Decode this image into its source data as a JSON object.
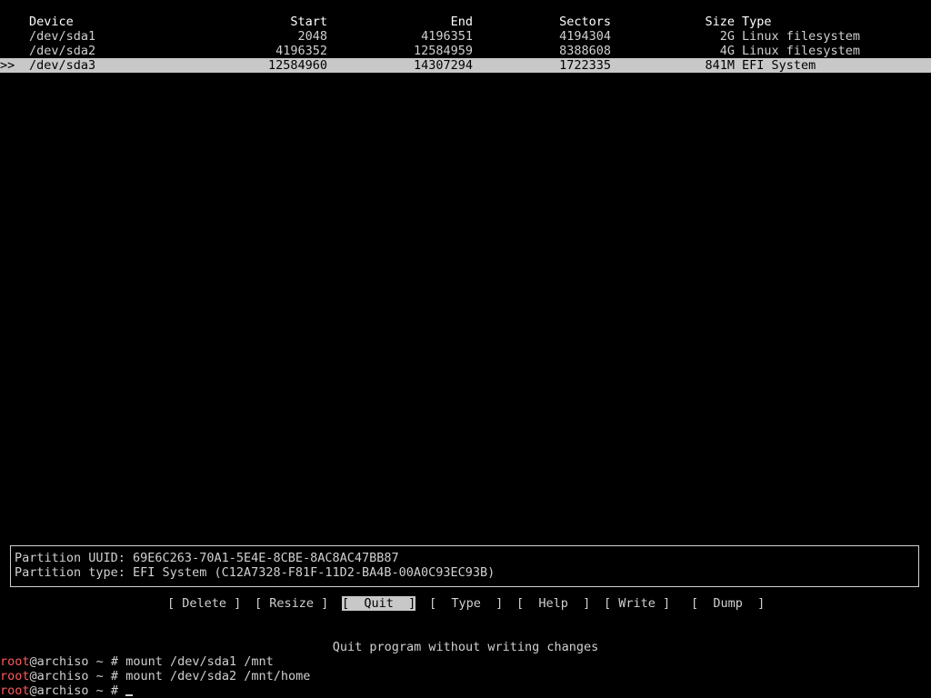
{
  "table": {
    "headers": {
      "device": "Device",
      "start": "Start",
      "end": "End",
      "sectors": "Sectors",
      "size": "Size",
      "type": "Type"
    },
    "rows": [
      {
        "marker": "",
        "device": "/dev/sda1",
        "start": "2048",
        "end": "4196351",
        "sectors": "4194304",
        "size": "2G",
        "type": "Linux filesystem",
        "selected": false
      },
      {
        "marker": "",
        "device": "/dev/sda2",
        "start": "4196352",
        "end": "12584959",
        "sectors": "8388608",
        "size": "4G",
        "type": "Linux filesystem",
        "selected": false
      },
      {
        "marker": ">>",
        "device": "/dev/sda3",
        "start": "12584960",
        "end": "14307294",
        "sectors": "1722335",
        "size": "841M",
        "type": "EFI System",
        "selected": true
      }
    ]
  },
  "info": {
    "uuid_line": "Partition UUID: 69E6C263-70A1-5E4E-8CBE-8AC8AC47BB87",
    "type_line": "Partition type: EFI System (C12A7328-F81F-11D2-BA4B-00A0C93EC93B)"
  },
  "menu": {
    "items": [
      {
        "label": "[ Delete ]",
        "active": false
      },
      {
        "label": "[ Resize ]",
        "active": false
      },
      {
        "label": "[  Quit  ]",
        "active": true
      },
      {
        "label": "[  Type  ]",
        "active": false
      },
      {
        "label": "[  Help  ]",
        "active": false
      },
      {
        "label": "[ Write ]",
        "active": false
      },
      {
        "label": "[  Dump  ]",
        "active": false
      }
    ]
  },
  "hint": "Quit program without writing changes",
  "shell": {
    "user": "root",
    "host_prompt": "@archiso ~ # ",
    "lines": [
      "mount /dev/sda1 /mnt",
      "mount /dev/sda2 /mnt/home",
      ""
    ]
  },
  "colors": {
    "background": "#000000",
    "text": "#d0d0d0",
    "selection": "#c8c8c8",
    "user": "#ff5a5a"
  }
}
